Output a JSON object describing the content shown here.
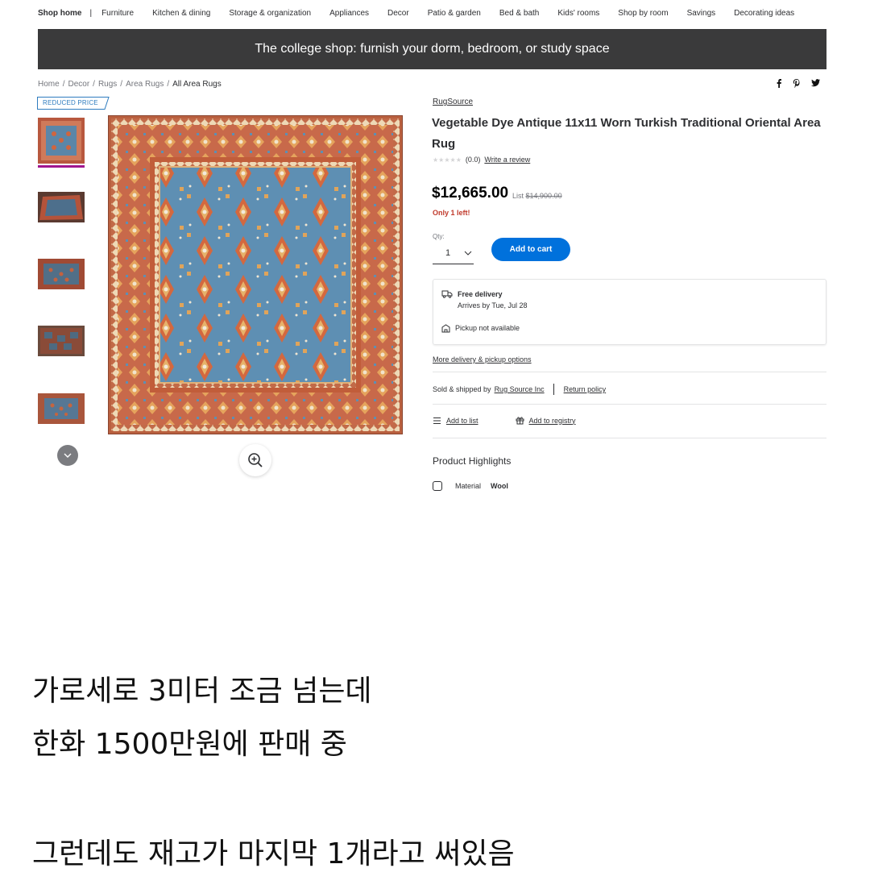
{
  "nav": {
    "home": "Shop home",
    "separator": "|",
    "items": [
      "Furniture",
      "Kitchen & dining",
      "Storage & organization",
      "Appliances",
      "Decor",
      "Patio & garden",
      "Bed & bath",
      "Kids' rooms",
      "Shop by room",
      "Savings",
      "Decorating ideas"
    ]
  },
  "banner": {
    "text": "The college shop: furnish your dorm, bedroom, or study space"
  },
  "breadcrumb": [
    "Home",
    "Decor",
    "Rugs",
    "Area Rugs",
    "All Area Rugs"
  ],
  "share": {
    "facebook": "f",
    "pinterest": "p",
    "twitter": "t"
  },
  "badge": {
    "reduced_price": "REDUCED PRICE"
  },
  "product": {
    "brand": "RugSource",
    "title": "Vegetable Dye Antique 11x11 Worn Turkish Traditional Oriental Area Rug",
    "stars": "★★★★★",
    "rating": "(0.0)",
    "write_review": "Write a review",
    "price": "$12,665.00",
    "list_label": "List",
    "list_price": "$14,900.00",
    "stock_note": "Only 1 left!",
    "qty_label": "Qty:",
    "qty_value": "1",
    "add_to_cart": "Add to cart"
  },
  "delivery": {
    "free_delivery": "Free delivery",
    "arrives": "Arrives by Tue, Jul 28",
    "pickup": "Pickup not available",
    "more_options": "More delivery & pickup options"
  },
  "seller": {
    "sold_label": "Sold & shipped by",
    "seller_name": "Rug Source Inc",
    "return_policy": "Return policy"
  },
  "actions": {
    "add_to_list": "Add to list",
    "add_to_registry": "Add to registry"
  },
  "highlights": {
    "title": "Product Highlights",
    "material_label": "Material",
    "material_value": "Wool"
  },
  "caption": {
    "line1": "가로세로 3미터 조금 넘는데",
    "line2": "한화 1500만원에 판매 중",
    "line3": "그런데도 재고가 마지막 1개라고 써있음"
  },
  "colors": {
    "accent_blue": "#0071dc",
    "banner_bg": "#3a3a3b",
    "stock_red": "#c0392b",
    "thumb_active": "#a0168f",
    "rug_border": "#c8694a",
    "rug_field": "#5e8fb3"
  }
}
